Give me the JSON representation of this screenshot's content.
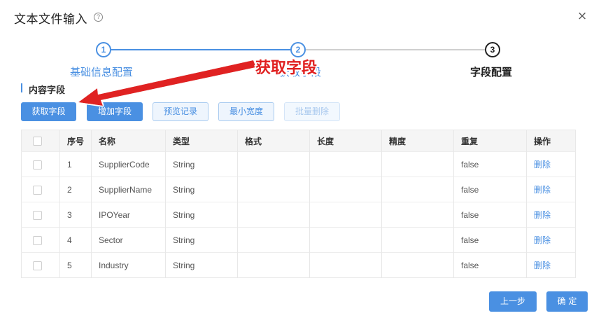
{
  "dialog": {
    "title": "文本文件输入",
    "help_icon": "?",
    "close_icon": "×"
  },
  "steps": [
    {
      "num": "1",
      "label": "基础信息配置"
    },
    {
      "num": "2",
      "label": "获取字段"
    },
    {
      "num": "3",
      "label": "字段配置"
    }
  ],
  "annotation": {
    "text": "获取字段"
  },
  "section": {
    "title": "内容字段"
  },
  "toolbar": {
    "fetch_label": "获取字段",
    "add_label": "增加字段",
    "preview_label": "预览记录",
    "minwidth_label": "最小宽度",
    "batch_delete_label": "批量删除"
  },
  "table": {
    "headers": [
      "序号",
      "名称",
      "类型",
      "格式",
      "长度",
      "精度",
      "重复",
      "操作"
    ],
    "rows": [
      {
        "no": "1",
        "name": "SupplierCode",
        "type": "String",
        "format": "",
        "length": "",
        "precision": "",
        "repeat": "false",
        "action": "删除"
      },
      {
        "no": "2",
        "name": "SupplierName",
        "type": "String",
        "format": "",
        "length": "",
        "precision": "",
        "repeat": "false",
        "action": "删除"
      },
      {
        "no": "3",
        "name": "IPOYear",
        "type": "String",
        "format": "",
        "length": "",
        "precision": "",
        "repeat": "false",
        "action": "删除"
      },
      {
        "no": "4",
        "name": "Sector",
        "type": "String",
        "format": "",
        "length": "",
        "precision": "",
        "repeat": "false",
        "action": "删除"
      },
      {
        "no": "5",
        "name": "Industry",
        "type": "String",
        "format": "",
        "length": "",
        "precision": "",
        "repeat": "false",
        "action": "删除"
      }
    ]
  },
  "footer": {
    "prev_label": "上一步",
    "ok_label": "确 定"
  },
  "colors": {
    "accent": "#4a90e2",
    "annotation": "#e02020"
  }
}
